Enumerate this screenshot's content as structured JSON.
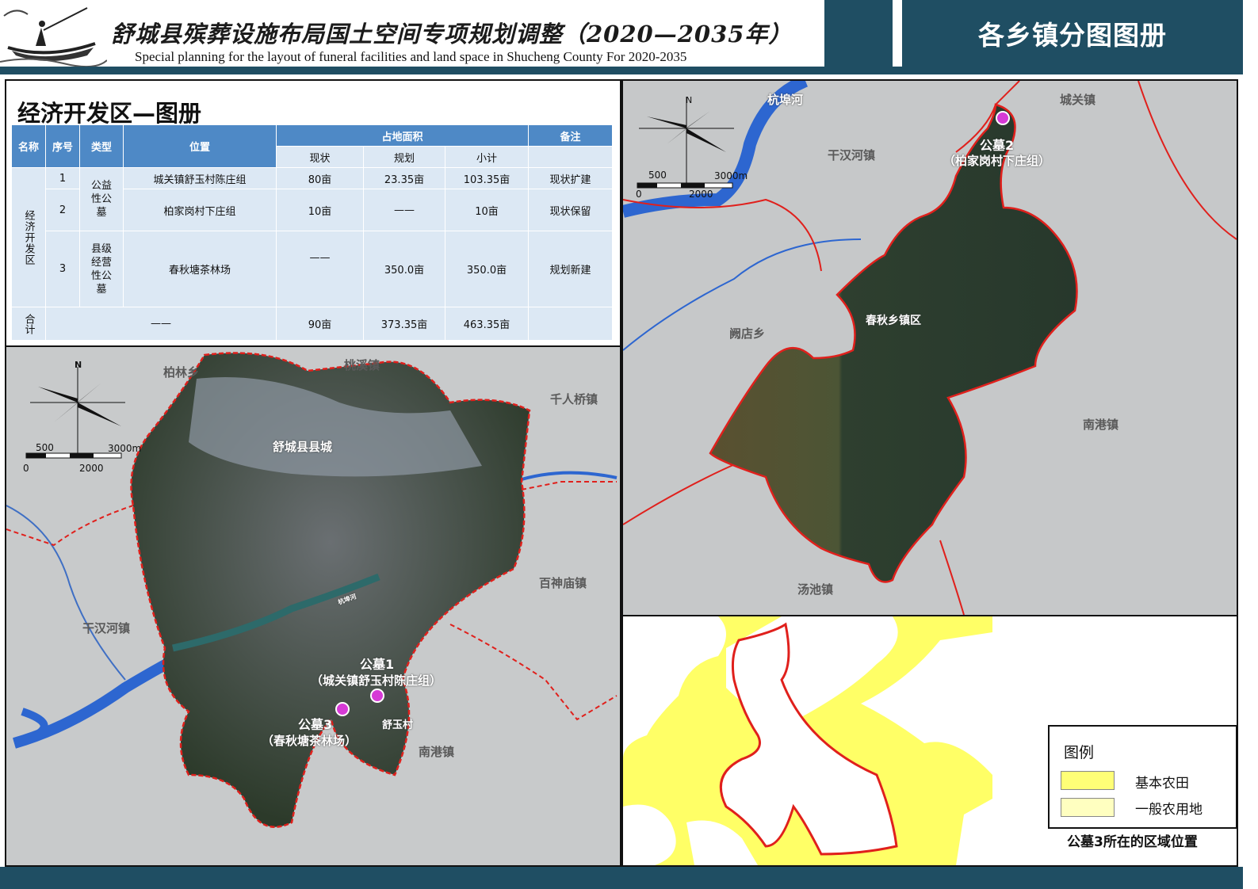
{
  "header": {
    "title": "舒城县殡葬设施布局国土空间专项规划调整（2020—2035年）",
    "subtitle": "Special planning for the layout of funeral facilities and land space in Shucheng County For 2020-2035",
    "right_title": "各乡镇分图图册"
  },
  "table_panel": {
    "title": "经济开发区—图册",
    "headers": {
      "name": "名称",
      "seq": "序号",
      "type": "类型",
      "location": "位置",
      "area": "占地面积",
      "note": "备注",
      "status": "现状",
      "plan": "规划",
      "subtotal": "小计"
    },
    "group_name": "经济开发区",
    "rows": [
      {
        "seq": "1",
        "location": "城关镇舒玉村陈庄组",
        "status": "80亩",
        "plan": "23.35亩",
        "subtotal": "103.35亩",
        "note": "现状扩建"
      },
      {
        "seq": "2",
        "location": "柏家岗村下庄组",
        "status": "10亩",
        "plan": "——",
        "subtotal": "10亩",
        "note": "现状保留"
      },
      {
        "seq": "3",
        "location": "春秋塘茶林场",
        "status": "——",
        "plan": "350.0亩",
        "subtotal": "350.0亩",
        "note": "规划新建"
      }
    ],
    "types": [
      "公益性公墓",
      "县级经营性公墓"
    ],
    "total": {
      "label": "合计",
      "middle": "——",
      "status": "90亩",
      "plan": "373.35亩",
      "subtotal": "463.35亩"
    }
  },
  "map_left": {
    "towns": [
      "柏林乡",
      "桃溪镇",
      "千人桥镇",
      "舒城县县城",
      "百神庙镇",
      "干汉河镇",
      "南港镇"
    ],
    "river_label": "杭埠河",
    "village": "舒玉村",
    "sites": [
      {
        "name": "公墓1",
        "desc": "（城关镇舒玉村陈庄组）"
      },
      {
        "name": "公墓3",
        "desc": "（春秋塘茶林场）"
      }
    ],
    "scale": {
      "mid": "500",
      "end": "3000m",
      "zero": "0",
      "lower": "2000"
    },
    "north": "N"
  },
  "map_right": {
    "towns": [
      "杭埠河",
      "城关镇",
      "干汉河镇",
      "阙店乡",
      "春秋乡镇区",
      "南港镇",
      "汤池镇"
    ],
    "sites": [
      {
        "name": "公墓2",
        "desc": "（柏家岗村下庄组）"
      }
    ],
    "scale": {
      "mid": "500",
      "end": "3000m",
      "zero": "0",
      "lower": "2000"
    },
    "north": "N"
  },
  "farmland_panel": {
    "caption": "公墓3所在的区域位置",
    "legend_title": "图例",
    "legend": [
      {
        "label": "基本农田",
        "color": "#ffff77"
      },
      {
        "label": "一般农用地",
        "color": "#ffffc0"
      }
    ]
  },
  "colors": {
    "accent": "#1f4e63",
    "table_header": "#4e89c6",
    "table_row": "#dce8f4",
    "boundary": "#e0201c",
    "site": "#d63ad6"
  }
}
